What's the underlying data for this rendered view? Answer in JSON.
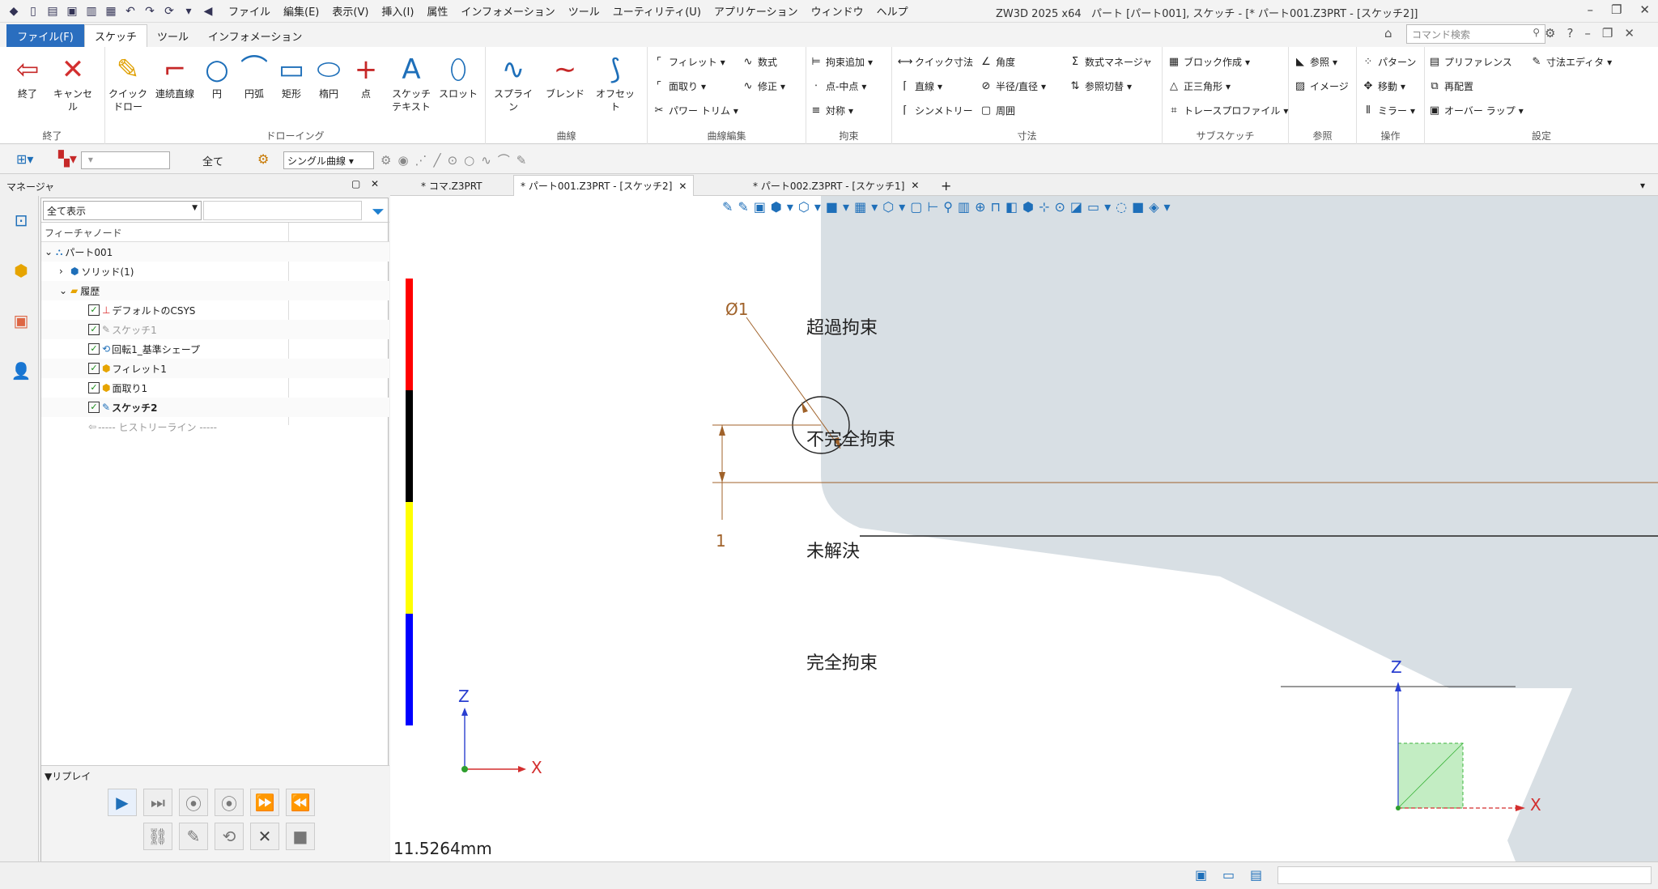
{
  "app": {
    "title": "ZW3D 2025 x64",
    "document_title": "パート [パート001], スケッチ - [* パート001.Z3PRT - [スケッチ2]]",
    "menu": [
      "ファイル",
      "編集(E)",
      "表示(V)",
      "挿入(I)",
      "属性",
      "インフォメーション",
      "ツール",
      "ユーティリティ(U)",
      "アプリケーション",
      "ウィンドウ",
      "ヘルプ"
    ]
  },
  "ribbon_tabs": {
    "file": "ファイル(F)",
    "tabs": [
      "スケッチ",
      "ツール",
      "インフォメーション"
    ],
    "active": "スケッチ"
  },
  "command_search": {
    "placeholder": "コマンド検索"
  },
  "ribbon": {
    "groups": {
      "exit": "終了",
      "draw": "ドローイング",
      "curve": "曲線",
      "curve_edit": "曲線編集",
      "constraint": "拘束",
      "dimension": "寸法",
      "subsketch": "サブスケッチ",
      "reference": "参照",
      "operation": "操作",
      "settings": "設定"
    },
    "big": {
      "exit": "終了",
      "cancel": "キャンセル",
      "quick_draw": "クイック ドロー",
      "polyline": "連続直線",
      "circle": "円",
      "arc": "円弧",
      "rect": "矩形",
      "ellipse": "楕円",
      "point": "点",
      "sketch_text": "スケッチ テキスト",
      "slot": "スロット",
      "spline": "スプライン",
      "blend": "ブレンド",
      "offset": "オフセット"
    },
    "small": {
      "fillet": "フィレット",
      "chamfer": "面取り",
      "power_trim": "パワー トリム",
      "formula": "数式",
      "modify": "修正",
      "add_constraint": "拘束追加",
      "point_mid": "点-中点",
      "symmetric": "対称",
      "quick_dim": "クイック寸法",
      "linear": "直線",
      "symmetry": "シンメトリー",
      "angle": "角度",
      "radius_dia": "半径/直径",
      "perimeter": "周囲",
      "formula_mgr": "数式マネージャ",
      "ref_switch": "参照切替",
      "block": "ブロック作成",
      "tri": "正三角形",
      "trace": "トレースプロファイル",
      "ref": "参照",
      "image": "イメージ",
      "pattern": "パターン",
      "move": "移動",
      "mirror": "ミラー",
      "preference": "プリファレンス",
      "relocate": "再配置",
      "overlap": "オーバー ラップ",
      "dim_editor": "寸法エディタ"
    }
  },
  "toolbar2": {
    "all": "全て",
    "curve_mode": "シングル曲線"
  },
  "manager": {
    "title": "マネージャ",
    "filter": "全て表示",
    "header": "フィーチャノード",
    "tree": [
      {
        "label": "パート001"
      },
      {
        "label": "ソリッド(1)"
      },
      {
        "label": "履歴"
      },
      {
        "label": "デフォルトのCSYS"
      },
      {
        "label": "スケッチ1"
      },
      {
        "label": "回転1_基準シェープ"
      },
      {
        "label": "フィレット1"
      },
      {
        "label": "面取り1"
      },
      {
        "label": "スケッチ2"
      },
      {
        "label": "----- ヒストリーライン -----"
      }
    ],
    "replay": "リプレイ"
  },
  "doc_tabs": [
    "* コマ.Z3PRT",
    "* パート001.Z3PRT - [スケッチ2]",
    "* パート002.Z3PRT - [スケッチ1]"
  ],
  "legend": [
    {
      "label": "超過拘束",
      "color": "#ff0000"
    },
    {
      "label": "不完全拘束",
      "color": "#000000"
    },
    {
      "label": "未解決",
      "color": "#ffff00"
    },
    {
      "label": "完全拘束",
      "color": "#0000ff"
    }
  ],
  "dimensions": {
    "diameter": "Ø1",
    "linear": "1"
  },
  "axis": {
    "z": "Z",
    "x": "X"
  },
  "measure": "11.5264mm",
  "colors": {
    "accent": "#2a6ebf",
    "part_fill": "#d8dfe4",
    "dim": "#a0622a"
  }
}
